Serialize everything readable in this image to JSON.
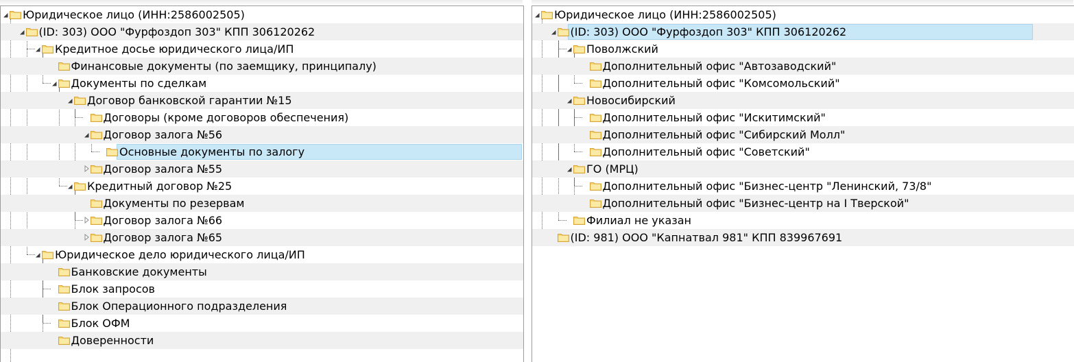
{
  "left_tree": {
    "rows": [
      {
        "level": 0,
        "expander": "expanded",
        "label": "Юридическое лицо (ИНН:2586002505)"
      },
      {
        "level": 1,
        "expander": "expanded",
        "label": " (ID: 303) ООО \"Фурфоздоп 303\" КПП 306120262"
      },
      {
        "level": 2,
        "expander": "expanded",
        "label": "Кредитное досье юридического лица/ИП"
      },
      {
        "level": 3,
        "expander": "none",
        "label": "Финансовые документы (по заемщику, принципалу)"
      },
      {
        "level": 3,
        "expander": "expanded",
        "label": "Документы по сделкам"
      },
      {
        "level": 4,
        "expander": "expanded",
        "label": "Договор банковской гарантии №15"
      },
      {
        "level": 5,
        "expander": "none",
        "label": "Договоры (кроме договоров обеспечения)"
      },
      {
        "level": 5,
        "expander": "expanded",
        "label": "Договор залога №56"
      },
      {
        "level": 6,
        "expander": "none",
        "label": "Основные документы по залогу",
        "selected": true
      },
      {
        "level": 5,
        "expander": "collapsed",
        "label": "Договор залога №55"
      },
      {
        "level": 4,
        "expander": "expanded",
        "label": "Кредитный договор №25"
      },
      {
        "level": 5,
        "expander": "none",
        "label": "Документы по резервам"
      },
      {
        "level": 5,
        "expander": "collapsed",
        "label": "Договор залога №66"
      },
      {
        "level": 5,
        "expander": "collapsed",
        "label": "Договор залога №65"
      },
      {
        "level": 2,
        "expander": "expanded",
        "label": "Юридическое дело юридического лица/ИП"
      },
      {
        "level": 3,
        "expander": "none",
        "label": "Банковские документы"
      },
      {
        "level": 3,
        "expander": "none",
        "label": "Блок запросов"
      },
      {
        "level": 3,
        "expander": "none",
        "label": "Блок Операционного подразделения"
      },
      {
        "level": 3,
        "expander": "none",
        "label": "Блок ОФМ"
      },
      {
        "level": 3,
        "expander": "none",
        "label": "Доверенности"
      }
    ]
  },
  "right_tree": {
    "rows": [
      {
        "level": 0,
        "expander": "expanded",
        "label": "Юридическое лицо (ИНН:2586002505)"
      },
      {
        "level": 1,
        "expander": "expanded",
        "label": " (ID: 303) ООО \"Фурфоздоп 303\" КПП 306120262",
        "selected": true
      },
      {
        "level": 2,
        "expander": "expanded",
        "label": "Поволжский"
      },
      {
        "level": 3,
        "expander": "none",
        "label": "Дополнительный офис \"Автозаводский\""
      },
      {
        "level": 3,
        "expander": "none",
        "label": "Дополнительный офис \"Комсомольский\""
      },
      {
        "level": 2,
        "expander": "expanded",
        "label": "Новосибирский"
      },
      {
        "level": 3,
        "expander": "none",
        "label": "Дополнительный офис \"Искитимский\""
      },
      {
        "level": 3,
        "expander": "none",
        "label": "Дополнительный офис \"Сибирский Молл\""
      },
      {
        "level": 3,
        "expander": "none",
        "label": "Дополнительный офис \"Советский\""
      },
      {
        "level": 2,
        "expander": "expanded",
        "label": "ГО (МРЦ)"
      },
      {
        "level": 3,
        "expander": "none",
        "label": "Дополнительный офис \"Бизнес-центр \"Ленинский, 73/8\""
      },
      {
        "level": 3,
        "expander": "none",
        "label": "Дополнительный офис \"Бизнес-центр на I Тверской\""
      },
      {
        "level": 2,
        "expander": "none",
        "label": "Филиал не указан"
      },
      {
        "level": 1,
        "expander": "none",
        "label": " (ID: 981) ООО \"Капнатвал 981\" КПП 839967691"
      }
    ]
  },
  "colors": {
    "selection_bg": "#c8e7f7",
    "selection_border": "#a8d4ee",
    "alt_row": "#f0f0f0",
    "folder_fill": "#f5d66e",
    "folder_edge": "#d7a43a"
  },
  "icons": {
    "folder": "folder-icon",
    "expanded": "expanded-triangle-icon",
    "collapsed": "collapsed-triangle-icon"
  }
}
